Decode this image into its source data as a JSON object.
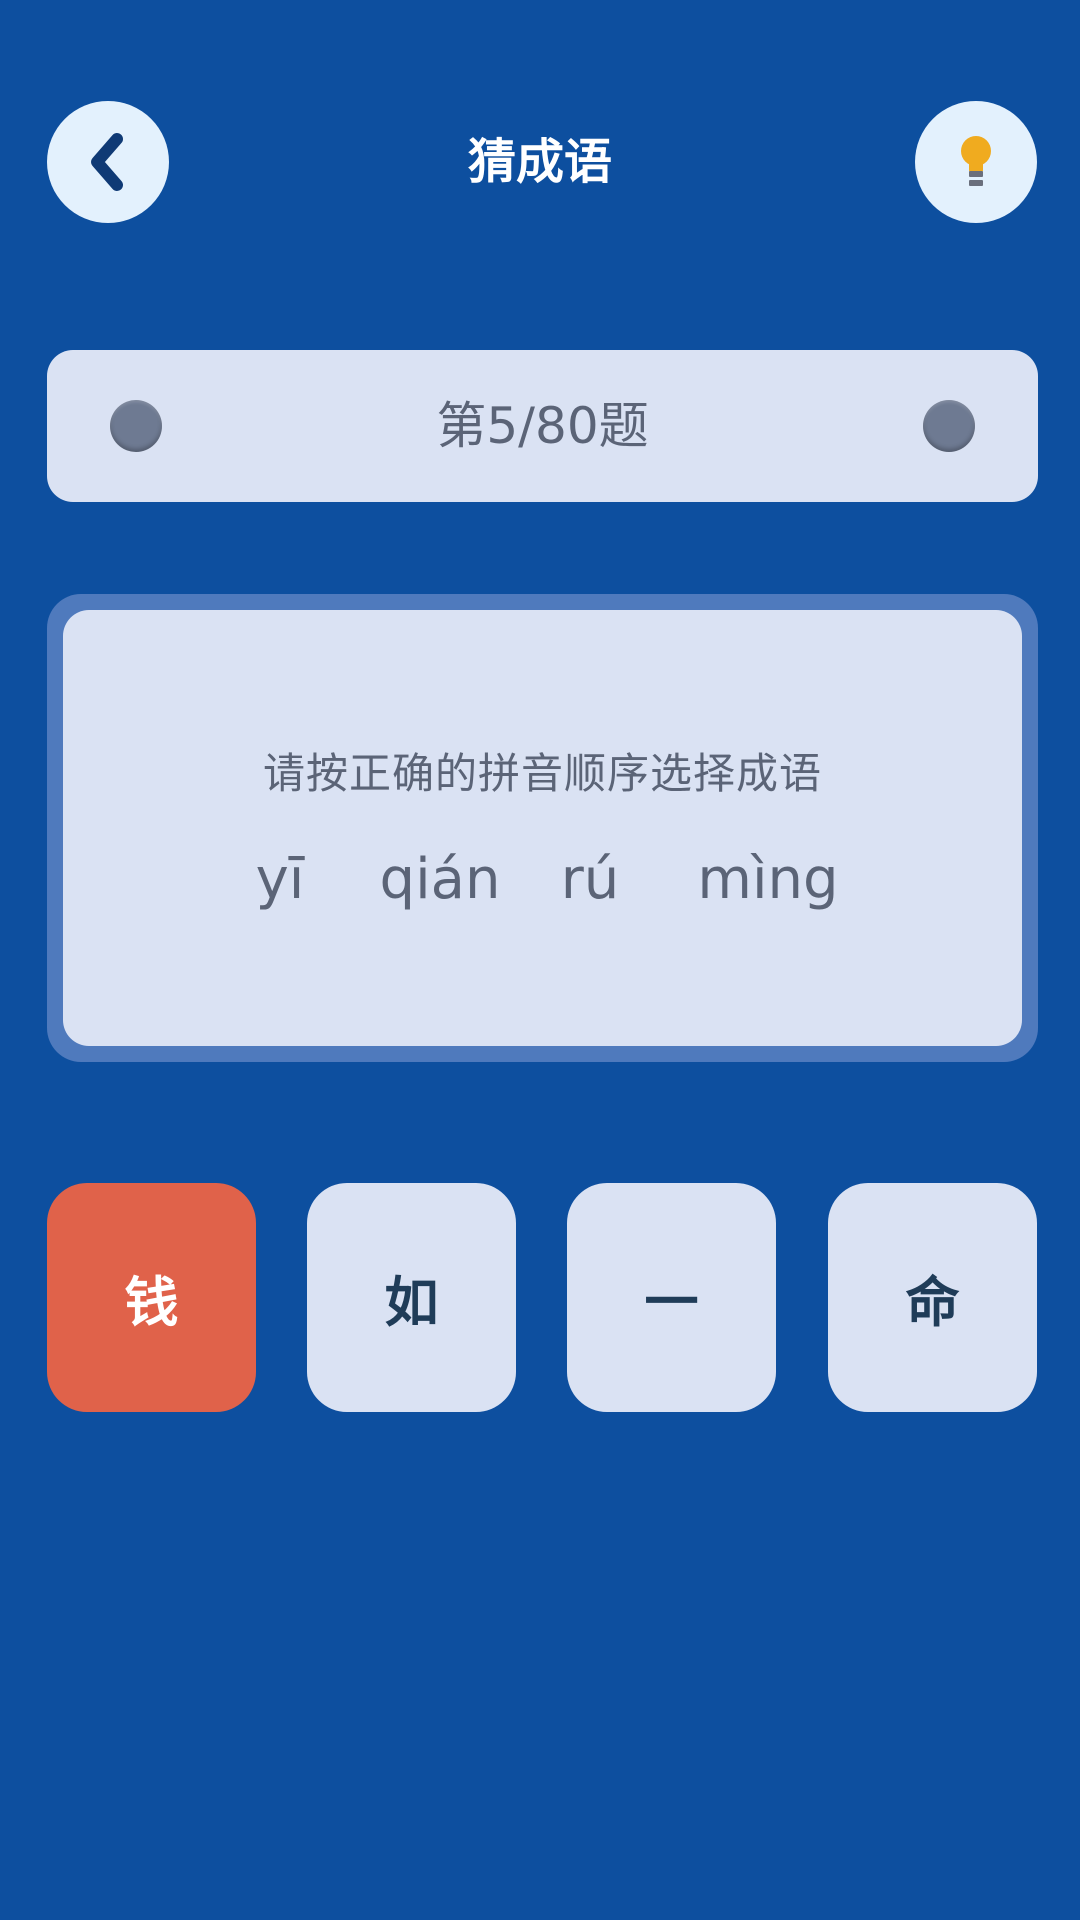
{
  "header": {
    "title": "猜成语",
    "back_icon": "chevron-left-icon",
    "hint_icon": "lightbulb-icon"
  },
  "progress": {
    "text": "第5/80题",
    "current": 5,
    "total": 80
  },
  "question": {
    "instruction": "请按正确的拼音顺序选择成语",
    "pinyin": [
      "yī",
      "qián",
      "rú",
      "mìng"
    ]
  },
  "options": [
    {
      "label": "钱",
      "selected": true
    },
    {
      "label": "如",
      "selected": false
    },
    {
      "label": "一",
      "selected": false
    },
    {
      "label": "命",
      "selected": false
    }
  ],
  "colors": {
    "background": "#0d4f9f",
    "card": "#dae2f3",
    "selected_option": "#e0624a",
    "hint_bulb": "#f0ab1f",
    "back_arrow": "#0f3a75"
  }
}
